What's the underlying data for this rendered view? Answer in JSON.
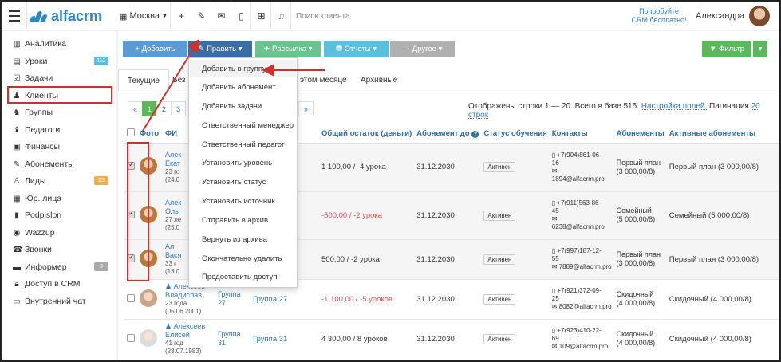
{
  "topbar": {
    "logo_text": "alfacrm",
    "city": "Москва",
    "search_placeholder": "Поиск клиента",
    "trial_line1": "Попробуйте",
    "trial_line2": "CRM бесплатно!",
    "user_name": "Александра"
  },
  "sidebar": {
    "items": [
      {
        "label": "Аналитика",
        "icon": "chart-icon"
      },
      {
        "label": "Уроки",
        "icon": "calendar-icon",
        "badge": "112"
      },
      {
        "label": "Задачи",
        "icon": "tasks-icon"
      },
      {
        "label": "Клиенты",
        "icon": "user-icon"
      },
      {
        "label": "Группы",
        "icon": "group-icon"
      },
      {
        "label": "Педагоги",
        "icon": "teacher-icon"
      },
      {
        "label": "Финансы",
        "icon": "money-icon"
      },
      {
        "label": "Абонементы",
        "icon": "subscription-icon"
      },
      {
        "label": "Лиды",
        "icon": "leads-icon",
        "badge": "25"
      },
      {
        "label": "Юр. лица",
        "icon": "building-icon"
      },
      {
        "label": "Podpislon",
        "icon": "doc-icon"
      },
      {
        "label": "Wazzup",
        "icon": "whatsapp-icon"
      },
      {
        "label": "Звонки",
        "icon": "phone-icon"
      },
      {
        "label": "Информер",
        "icon": "informer-icon",
        "badge": "3"
      },
      {
        "label": "Доступ в CRM",
        "icon": "lock-icon"
      },
      {
        "label": "Внутренний чат",
        "icon": "chat-icon"
      }
    ],
    "badge_colors": {
      "112": "#5bc0de",
      "25": "#f0ad4e",
      "3": "#aaaaaa"
    }
  },
  "toolbar": {
    "add": "+ Добавить",
    "edit": "✎ Править ▾",
    "mailing": "✈ Рассылка ▾",
    "reports": "⛃ Отчеты ▾",
    "other": "··· Другое ▾",
    "filter": "▼ Фильтр"
  },
  "tabs": {
    "current": "Текущие",
    "no": "Без",
    "this_month": "этом месяце",
    "archive": "Архивные"
  },
  "pagination": {
    "pages": [
      "«",
      "1",
      "2",
      "3",
      "»"
    ],
    "current": "1"
  },
  "info": {
    "text": "Отображены строки 1 — 20. Всего в базе 515.",
    "settings_link": "Настройка полей.",
    "pagination_text": "Пагинация",
    "per_page_link": "20 строк"
  },
  "table": {
    "headers": [
      "Фото",
      "ФИ",
      "руппы",
      "Общий остаток (деньги)",
      "Абонемент до",
      "Статус обучения",
      "Контакты",
      "Абонементы",
      "Активные абонементы"
    ],
    "rows": [
      {
        "name1": "Алек",
        "name2": "Екат",
        "age": "23 го",
        "dob": "(24.0",
        "group": "",
        "group2": "",
        "balance": "1 100,00 / -4 урока",
        "balance_red": false,
        "until": "31.12.2030",
        "status": "Активен",
        "phone": "+7(904)861-06-",
        "phone2": "16",
        "email": "1894@alfacrm.pro",
        "abon": "Первый план",
        "abon2": "(3 000,00/8)",
        "active": "Первый план (3 000,00/8)",
        "checked": true
      },
      {
        "name1": "Алек",
        "name2": "Олы",
        "age": "27 ле",
        "dob": "(25.0",
        "group": "",
        "group2": "",
        "balance": "-500,00 / -2 урока",
        "balance_red": true,
        "until": "31.12.2030",
        "status": "Активен",
        "phone": "+7(911)563-86-",
        "phone2": "45",
        "email": "6238@alfacrm.pro",
        "abon": "Семейный",
        "abon2": "(5 000,00/8)",
        "active": "Семейный (5 000,00/8)",
        "checked": true
      },
      {
        "name1": "Ал",
        "name2": "Вася",
        "age": "33 г",
        "dob": "(13.0",
        "group": "",
        "group2": "",
        "balance": "500,00 / -2 урока",
        "balance_red": false,
        "until": "31.12.2030",
        "status": "Активен",
        "phone": "+7(997)187-12-",
        "phone2": "55",
        "email": "7889@alfacrm.pro",
        "abon": "Первый план",
        "abon2": "(3 000,00/8)",
        "active": "Первый план (3 000,00/8)",
        "checked": true
      },
      {
        "name1": "Алексеев",
        "name2": "Владислав",
        "age": "23 года",
        "dob": "(05.06.2001)",
        "group": "Группа",
        "group2": "27",
        "group_full": "Группа 27",
        "balance": "-1 100,00 / -5 уроков",
        "balance_red": true,
        "until": "31.12.2030",
        "status": "Активен",
        "phone": "+7(921)372-09-",
        "phone2": "25",
        "email": "8082@alfacrm.pro",
        "abon": "Скидочный",
        "abon2": "(4 000,00/8)",
        "active": "Скидочный (4 000,00/8)",
        "checked": false
      },
      {
        "name1": "Алексеев",
        "name2": "Елисей",
        "age": "41 год",
        "dob": "(28.07.1983)",
        "group": "Группа",
        "group2": "31",
        "group_full": "Группа 31",
        "balance": "4 300,00 / 8 уроков",
        "balance_red": false,
        "until": "31.12.2030",
        "status": "Активен",
        "phone": "+7(923)410-22-",
        "phone2": "69",
        "email": "109@alfacrm.pro",
        "abon": "Скидочный",
        "abon2": "(4 000,00/8)",
        "active": "Скидочный (4 000,00/8)",
        "checked": false
      }
    ]
  },
  "dropdown": {
    "items": [
      "Добавить в группу",
      "Добавить абонемент",
      "Добавить задачи",
      "Ответственный менеджер",
      "Ответственный педагог",
      "Установить уровень",
      "Установить статус",
      "Установить источник",
      "Отправить в архив",
      "Вернуть из архива",
      "Окончательно удалить",
      "Предоставить доступ"
    ]
  },
  "colors": {
    "primary": "#5b9bd5",
    "edit": "#3a6ea5",
    "green": "#5cb85c",
    "teal": "#5bc0de",
    "gray": "#b0b0b0",
    "annotation": "#d0302b"
  }
}
